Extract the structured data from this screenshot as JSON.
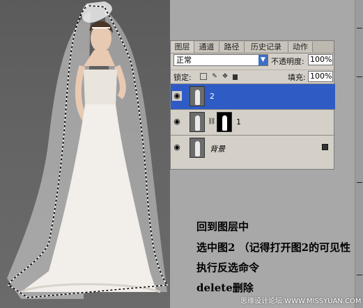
{
  "layers_panel": {
    "tabs": [
      {
        "label": "图层",
        "active": true
      },
      {
        "label": "通道",
        "active": false
      },
      {
        "label": "路径",
        "active": false
      },
      {
        "label": "历史记录",
        "active": false
      },
      {
        "label": "动作",
        "active": false
      }
    ],
    "blend_mode": "正常",
    "opacity_label": "不透明度:",
    "opacity_value": "100%",
    "lock_label": "锁定:",
    "fill_label": "填充:",
    "fill_value": "100%",
    "layers": [
      {
        "name": "2",
        "selected": true,
        "visible": true,
        "has_mask": false
      },
      {
        "name": "1",
        "selected": false,
        "visible": true,
        "has_mask": true
      },
      {
        "name": "背景",
        "selected": false,
        "visible": true,
        "has_mask": false,
        "locked": true
      }
    ]
  },
  "instructions": [
    "回到图层中",
    "选中图2 （记得打开图2的可见性",
    "执行反选命令",
    "delete删除"
  ],
  "watermark": "思缘设计论坛 WWW.MISSYUAN.COM",
  "colors": {
    "selection_blue": "#2f5bc4",
    "panel_gray": "#d4d0c8",
    "photo_background": "#5f5f5f"
  }
}
